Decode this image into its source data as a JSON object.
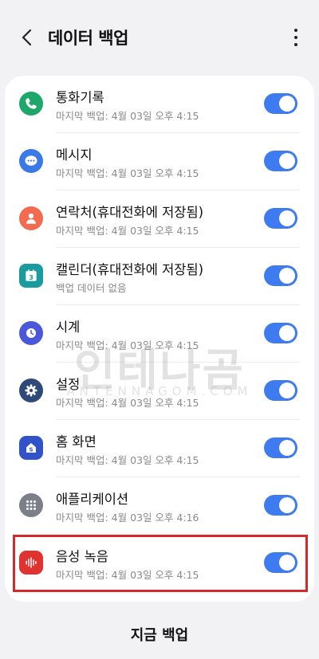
{
  "header": {
    "title": "데이터 백업"
  },
  "items": [
    {
      "label": "통화기록",
      "sub": "마지막 백업: 4월 03일 오후 4:15",
      "icon": "phone-icon",
      "color": "#1ea76b",
      "enabled": true
    },
    {
      "label": "메시지",
      "sub": "마지막 백업: 4월 03일 오후 4:15",
      "icon": "message-icon",
      "color": "#3b79e6",
      "enabled": true
    },
    {
      "label": "연락처(휴대전화에 저장됨)",
      "sub": "마지막 백업: 4월 03일 오후 4:15",
      "icon": "contact-icon",
      "color": "#f26a4f",
      "enabled": true
    },
    {
      "label": "캘린더(휴대전화에 저장됨)",
      "sub": "백업 데이터 없음",
      "icon": "calendar-icon",
      "color": "#1b9aa0",
      "enabled": true
    },
    {
      "label": "시계",
      "sub": "마지막 백업: 4월 03일 오후 4:15",
      "icon": "clock-icon",
      "color": "#4a57d9",
      "enabled": true
    },
    {
      "label": "설정",
      "sub": "마지막 백업: 4월 03일 오후 4:15",
      "icon": "gear-icon",
      "color": "#2f4a7a",
      "enabled": true
    },
    {
      "label": "홈 화면",
      "sub": "마지막 백업: 4월 03일 오후 4:15",
      "icon": "home-icon",
      "color": "#3152c9",
      "enabled": true
    },
    {
      "label": "애플리케이션",
      "sub": "마지막 백업: 4월 03일 오후 4:16",
      "icon": "apps-icon",
      "color": "#7a7f8a",
      "enabled": true
    },
    {
      "label": "음성 녹음",
      "sub": "마지막 백업: 4월 03일 오후 4:15",
      "icon": "voice-recorder-icon",
      "color": "#e0322f",
      "enabled": true
    }
  ],
  "watermark": {
    "title": "인테나곰",
    "url": "ANTENNAGOM.COM"
  },
  "footer": {
    "backup_now": "지금 백업"
  }
}
